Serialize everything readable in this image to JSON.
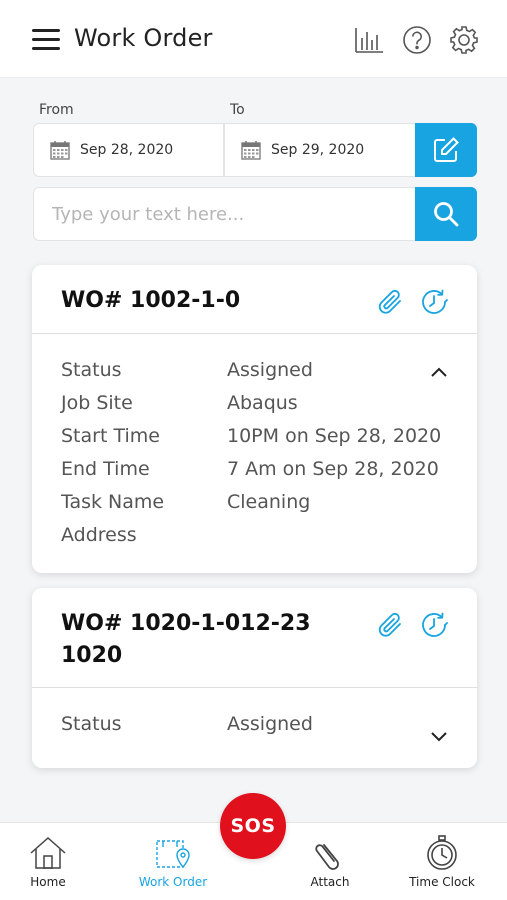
{
  "header": {
    "title": "Work Order",
    "icons": [
      "menu-icon",
      "bar-chart-icon",
      "help-icon",
      "settings-icon"
    ]
  },
  "filters": {
    "from_label": "From",
    "to_label": "To",
    "from_date": "Sep 28, 2020",
    "to_date": "Sep 29, 2020"
  },
  "search": {
    "placeholder": "Type your text here...",
    "value": ""
  },
  "work_orders": [
    {
      "title": "WO# 1002-1-0",
      "rows": [
        {
          "key": "Status",
          "value": "Assigned"
        },
        {
          "key": "Job Site",
          "value": "Abaqus"
        },
        {
          "key": "Start Time",
          "value": "10PM on Sep 28, 2020"
        },
        {
          "key": "End Time",
          "value": "7 Am on Sep 28, 2020"
        },
        {
          "key": "Task Name",
          "value": "Cleaning"
        },
        {
          "key": "Address",
          "value": ""
        }
      ],
      "expanded": true
    },
    {
      "title_line1": "WO# 1020-1-012-23",
      "title_line2": "1020",
      "rows": [
        {
          "key": "Status",
          "value": "Assigned"
        }
      ],
      "expanded": false
    }
  ],
  "sos_label": "SOS",
  "bottom_nav": [
    {
      "label": "Home",
      "icon": "home-icon",
      "active": false
    },
    {
      "label": "Work Order",
      "icon": "work-order-icon",
      "active": true
    },
    {
      "label": "Attach",
      "icon": "paperclip-icon",
      "active": false
    },
    {
      "label": "Time Clock",
      "icon": "stopwatch-icon",
      "active": false
    }
  ],
  "colors": {
    "accent": "#17a4e0",
    "sos": "#e0101d",
    "background": "#f4f5f7"
  }
}
